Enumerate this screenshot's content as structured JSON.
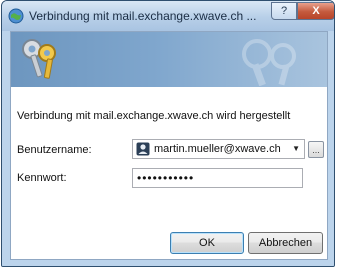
{
  "window": {
    "title": "Verbindung mit mail.exchange.xwave.ch ...",
    "help_label": "?",
    "close_label": "X"
  },
  "dialog": {
    "message": "Verbindung mit mail.exchange.xwave.ch wird hergestellt",
    "username_label": "Benutzername:",
    "username_value": "martin.mueller@xwave.ch",
    "password_label": "Kennwort:",
    "password_value": "•••••••••••",
    "browse_label": "...",
    "ok_label": "OK",
    "cancel_label": "Abbrechen"
  },
  "icons": {
    "title": "security-globe-icon",
    "banner": "keys-icon",
    "user": "user-card-icon",
    "dropdown": "chevron-down-icon"
  },
  "colors": {
    "banner_start": "#6d96bf",
    "banner_end": "#a9c4de",
    "default_button_border": "#3c7fb1"
  }
}
